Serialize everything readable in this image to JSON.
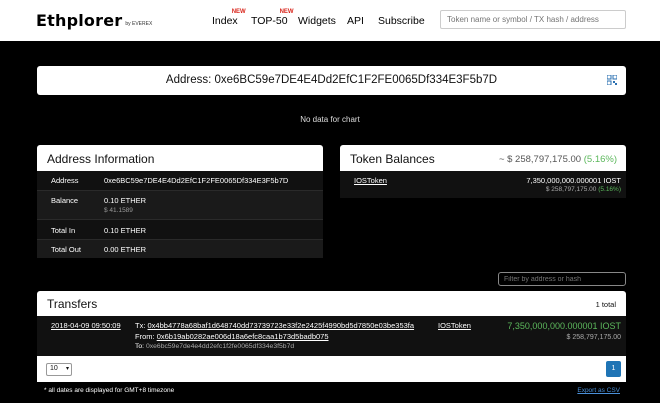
{
  "header": {
    "logo": "Ethplorer",
    "logo_by": "by EVEREX",
    "nav": [
      {
        "label": "Index",
        "badge": "NEW"
      },
      {
        "label": "TOP-50",
        "badge": "NEW"
      },
      {
        "label": "Widgets"
      },
      {
        "label": "API"
      },
      {
        "label": "Subscribe"
      }
    ],
    "search_placeholder": "Token name or symbol / TX hash / address"
  },
  "address": {
    "title": "Address: 0xe6BC59e7DE4E4Dd2EfC1F2FE0065Df334E3F5b7D"
  },
  "chart_message": "No data for chart",
  "address_info": {
    "title": "Address Information",
    "rows": [
      {
        "key": "Address",
        "value": "0xe6BC59e7DE4E4Dd2EfC1F2FE0065Df334E3F5b7D"
      },
      {
        "key": "Balance",
        "value": "0.10 ETHER",
        "sub": "$ 41.1589"
      },
      {
        "key": "Total In",
        "value": "0.10 ETHER"
      },
      {
        "key": "Total Out",
        "value": "0.00 ETHER"
      }
    ]
  },
  "token_balances": {
    "title": "Token Balances",
    "total": "~ $ 258,797,175.00",
    "change": "(5.16%)",
    "items": [
      {
        "name": "IOSToken",
        "amount": "7,350,000,000.000001 IOST",
        "usd": "$ 258,797,175.00",
        "change": "(5.16%)"
      }
    ]
  },
  "filter_placeholder": "Filter by address or hash",
  "transfers": {
    "title": "Transfers",
    "count": "1 total",
    "rows": [
      {
        "date": "2018-04-09 09:50:09",
        "tx_label": "Tx:",
        "tx": "0x4bb4778a68baf1d648740dd73739723e33f2e2425f4990bd5d7850e03be353fa",
        "from_label": "From:",
        "from": "0x6b19ab0282ae006d18a6efc8caa1b73d5badb075",
        "to_label": "To:",
        "to": "0xe6bc59e7de4e4dd2efc1f2fe0065df334e3f5b7d",
        "token": "IOSToken",
        "amount": "7,350,000,000.000001 IOST",
        "usd": "$ 258,797,175.00"
      }
    ],
    "page_size": "10",
    "page": "1"
  },
  "footnote": "* all dates are displayed for GMT+8 timezone",
  "export_label": "Export as CSV",
  "colors": {
    "accent": "#1f74b5",
    "positive": "#5cb85c"
  }
}
